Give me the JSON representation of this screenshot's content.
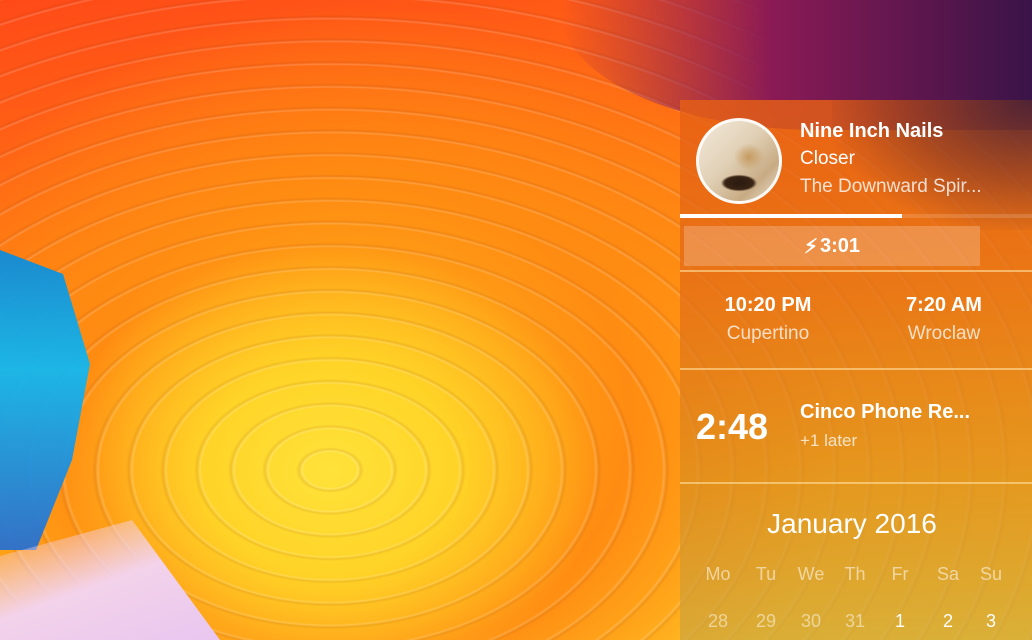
{
  "now_playing": {
    "artist": "Nine Inch Nails",
    "title": "Closer",
    "album": "The Downward Spir...",
    "progress": 0.63
  },
  "battery": {
    "time": "3:01",
    "icon": "bolt-icon"
  },
  "world_clock": [
    {
      "time": "10:20 PM",
      "city": "Cupertino"
    },
    {
      "time": "7:20 AM",
      "city": "Wroclaw"
    }
  ],
  "event": {
    "countdown": "2:48",
    "title": "Cinco Phone Re...",
    "later": "+1 later"
  },
  "calendar": {
    "title": "January 2016",
    "weekdays": [
      "Mo",
      "Tu",
      "We",
      "Th",
      "Fr",
      "Sa",
      "Su"
    ],
    "first_row": [
      "28",
      "29",
      "30",
      "31",
      "1",
      "2",
      "3"
    ]
  }
}
